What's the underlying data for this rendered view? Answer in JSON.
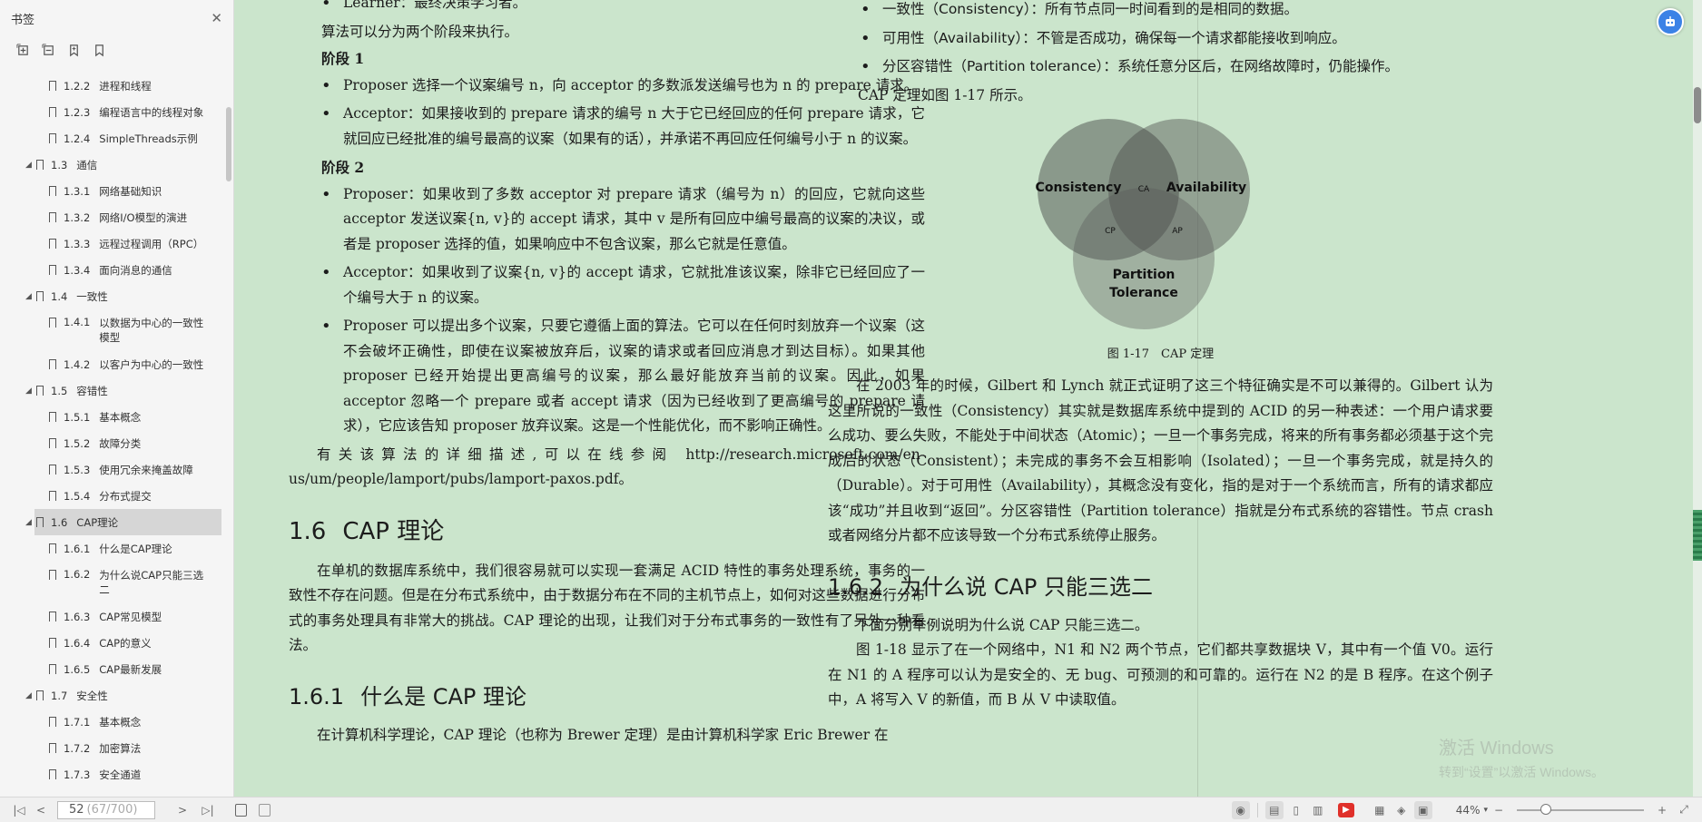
{
  "sidebar": {
    "title": "书签",
    "close_icon": "close-icon",
    "tools": [
      "expand-all-icon",
      "collapse-all-icon",
      "add-bookmark-icon",
      "bookmark-icon"
    ],
    "items": [
      {
        "num": "1.2.2",
        "label": "进程和线程",
        "level": 3
      },
      {
        "num": "1.2.3",
        "label": "编程语言中的线程对象",
        "level": 3
      },
      {
        "num": "1.2.4",
        "label": "SimpleThreads示例",
        "level": 3
      },
      {
        "num": "1.3",
        "label": "通信",
        "level": 2
      },
      {
        "num": "1.3.1",
        "label": "网络基础知识",
        "level": 3
      },
      {
        "num": "1.3.2",
        "label": "网络I/O模型的演进",
        "level": 3
      },
      {
        "num": "1.3.3",
        "label": "远程过程调用（RPC）",
        "level": 3
      },
      {
        "num": "1.3.4",
        "label": "面向消息的通信",
        "level": 3
      },
      {
        "num": "1.4",
        "label": "一致性",
        "level": 2
      },
      {
        "num": "1.4.1",
        "label": "以数据为中心的一致性模型",
        "level": 3
      },
      {
        "num": "1.4.2",
        "label": "以客户为中心的一致性",
        "level": 3
      },
      {
        "num": "1.5",
        "label": "容错性",
        "level": 2
      },
      {
        "num": "1.5.1",
        "label": "基本概念",
        "level": 3
      },
      {
        "num": "1.5.2",
        "label": "故障分类",
        "level": 3
      },
      {
        "num": "1.5.3",
        "label": "使用冗余来掩盖故障",
        "level": 3
      },
      {
        "num": "1.5.4",
        "label": "分布式提交",
        "level": 3
      },
      {
        "num": "1.6",
        "label": "CAP理论",
        "level": 2
      },
      {
        "num": "1.6.1",
        "label": "什么是CAP理论",
        "level": 3
      },
      {
        "num": "1.6.2",
        "label": "为什么说CAP只能三选二",
        "level": 3
      },
      {
        "num": "1.6.3",
        "label": "CAP常见模型",
        "level": 3
      },
      {
        "num": "1.6.4",
        "label": "CAP的意义",
        "level": 3
      },
      {
        "num": "1.6.5",
        "label": "CAP最新发展",
        "level": 3
      },
      {
        "num": "1.7",
        "label": "安全性",
        "level": 2
      },
      {
        "num": "1.7.1",
        "label": "基本概念",
        "level": 3
      },
      {
        "num": "1.7.2",
        "label": "加密算法",
        "level": 3
      },
      {
        "num": "1.7.3",
        "label": "安全通道",
        "level": 3
      }
    ]
  },
  "page_left": {
    "top_fragment": "Learner：最终决策学习者。",
    "intro": "算法可以分为两个阶段来执行。",
    "stage1": "阶段 1",
    "s1_b1": "Proposer 选择一个议案编号 n，向 acceptor 的多数派发送编号也为 n 的 prepare 请求。",
    "s1_b2": "Acceptor：如果接收到的 prepare 请求的编号 n 大于它已经回应的任何 prepare 请求，它就回应已经批准的编号最高的议案（如果有的话），并承诺不再回应任何编号小于 n 的议案。",
    "stage2": "阶段 2",
    "s2_b1": "Proposer：如果收到了多数 acceptor 对 prepare 请求（编号为 n）的回应，它就向这些 acceptor 发送议案{n, v}的 accept 请求，其中 v 是所有回应中编号最高的议案的决议，或者是 proposer 选择的值，如果响应中不包含议案，那么它就是任意值。",
    "s2_b2": "Acceptor：如果收到了议案{n, v}的 accept 请求，它就批准该议案，除非它已经回应了一个编号大于 n 的议案。",
    "s2_b3": "Proposer 可以提出多个议案，只要它遵循上面的算法。它可以在任何时刻放弃一个议案（这不会破坏正确性，即使在议案被放弃后，议案的请求或者回应消息才到达目标）。如果其他 proposer 已经开始提出更高编号的议案，那么最好能放弃当前的议案。因此，如果 acceptor 忽略一个 prepare 或者 accept 请求（因为已经收到了更高编号的 prepare 请求），它应该告知 proposer 放弃议案。这是一个性能优化，而不影响正确性。",
    "online_ref": "有关该算法的详细描述,可以在线参阅 http://research.microsoft.com/en-us/um/people/lamport/pubs/lamport-paxos.pdf。",
    "sec_num": "1.6",
    "sec_title": "CAP 理论",
    "sec_para": "在单机的数据库系统中，我们很容易就可以实现一套满足 ACID 特性的事务处理系统，事务的一致性不存在问题。但是在分布式系统中，由于数据分布在不同的主机节点上，如何对这些数据进行分布式的事务处理具有非常大的挑战。CAP 理论的出现，让我们对于分布式事务的一致性有了另外一种看法。",
    "sub_num": "1.6.1",
    "sub_title": "什么是 CAP 理论",
    "sub_para": "在计算机科学理论，CAP 理论（也称为 Brewer 定理）是由计算机科学家 Eric Brewer 在"
  },
  "page_right": {
    "b1_head": "一致性（Consistency）：",
    "b1_text": "所有节点同一时间看到的是相同的数据。",
    "b2_head": "可用性（Availability）：",
    "b2_text": "不管是否成功，确保每一个请求都能接收到响应。",
    "b3_head": "分区容错性（Partition tolerance）：",
    "b3_text": "系统任意分区后，在网络故障时，仍能操作。",
    "fig_intro": "CAP 定理如图 1-17 所示。",
    "venn": {
      "c": "Consistency",
      "a": "Availability",
      "p1": "Partition",
      "p2": "Tolerance",
      "ca": "CA",
      "cp": "CP",
      "ap": "AP"
    },
    "fig_caption": "图 1-17　CAP 定理",
    "para1": "在 2003 年的时候，Gilbert 和 Lynch 就正式证明了这三个特征确实是不可以兼得的。Gilbert 认为这里所说的一致性（Consistency）其实就是数据库系统中提到的 ACID 的另一种表述：一个用户请求要么成功、要么失败，不能处于中间状态（Atomic）；一旦一个事务完成，将来的所有事务都必须基于这个完成后的状态（Consistent）；未完成的事务不会互相影响（Isolated）；一旦一个事务完成，就是持久的（Durable）。对于可用性（Availability），其概念没有变化，指的是对于一个系统而言，所有的请求都应该“成功”并且收到“返回”。分区容错性（Partition tolerance）指就是分布式系统的容错性。节点 crash 或者网络分片都不应该导致一个分布式系统停止服务。",
    "sub_num": "1.6.2",
    "sub_title": "为什么说 CAP 只能三选二",
    "para2": "下面分别举例说明为什么说 CAP 只能三选二。",
    "para3": "图 1-18 显示了在一个网络中，N1 和 N2 两个节点，它们都共享数据块 V，其中有一个值 V0。运行在 N1 的 A 程序可以认为是安全的、无 bug、可预测的和可靠的。运行在 N2 的是 B 程序。在这个例子中，A 将写入 V 的新值，而 B 从 V 中读取值。"
  },
  "watermark": {
    "line1": "激活 Windows",
    "line2": "转到“设置”以激活 Windows。"
  },
  "statusbar": {
    "page_current": "52",
    "page_total": "(67/700)",
    "zoom": "44%"
  },
  "colors": {
    "page_bg": "#cbe5cc",
    "accent": "#3b82e6",
    "record": "#e0302a"
  }
}
